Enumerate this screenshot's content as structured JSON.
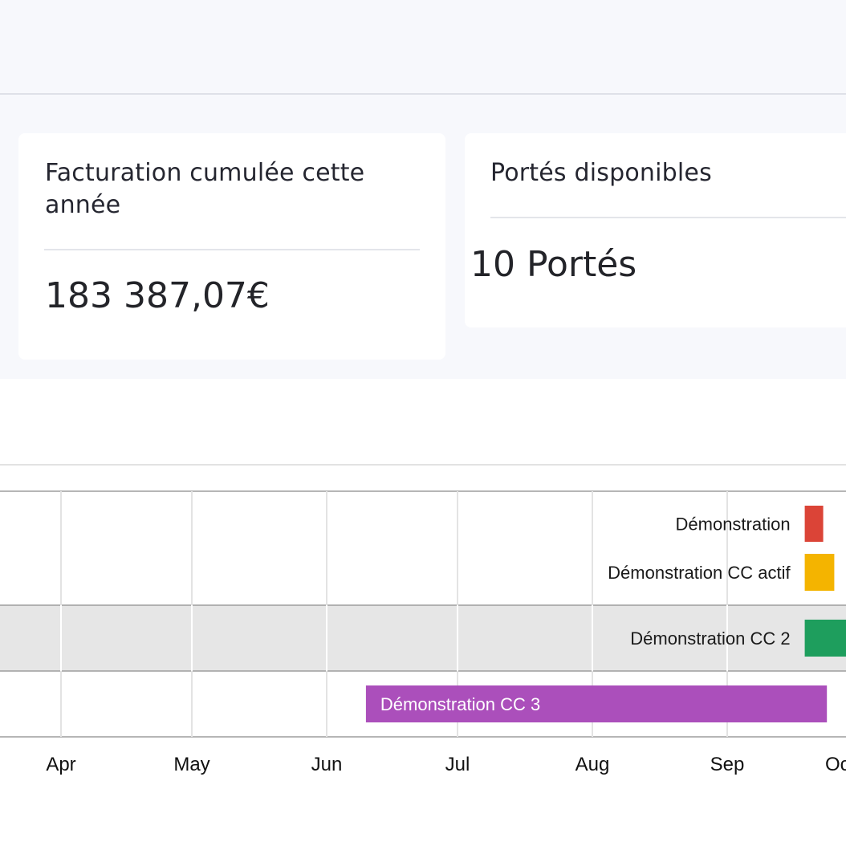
{
  "cards": [
    {
      "title_line1": "Facturation cumulée cette",
      "title_line2": "année",
      "value": "183 387,07€"
    },
    {
      "title_line1": "Portés disponibles",
      "value": "10 Portés"
    }
  ],
  "chart_data": {
    "type": "timeline",
    "x_ticks": [
      "Apr",
      "May",
      "Jun",
      "Jul",
      "Aug",
      "Sep",
      "Oc"
    ],
    "rows": [
      {
        "shaded": false,
        "bars": [
          {
            "label": "Démonstration",
            "start": "2020-09-22",
            "end": "2020-09-27",
            "color": "#db4437",
            "label_position": "left"
          },
          {
            "label": "Démonstration CC actif",
            "start": "2020-09-22",
            "end": "2020-09-30",
            "color": "#f4b400",
            "label_position": "left"
          }
        ]
      },
      {
        "shaded": true,
        "bars": [
          {
            "label": "Démonstration CC 2",
            "start": "2020-09-22",
            "end": "2020-10-15",
            "color": "#1e9e5d",
            "label_position": "left"
          }
        ]
      },
      {
        "shaded": false,
        "bars": [
          {
            "label": "Démonstration CC 3",
            "start": "2020-06-10",
            "end": "2020-09-28",
            "color": "#ab4fbb",
            "label_position": "inside"
          }
        ]
      }
    ]
  }
}
